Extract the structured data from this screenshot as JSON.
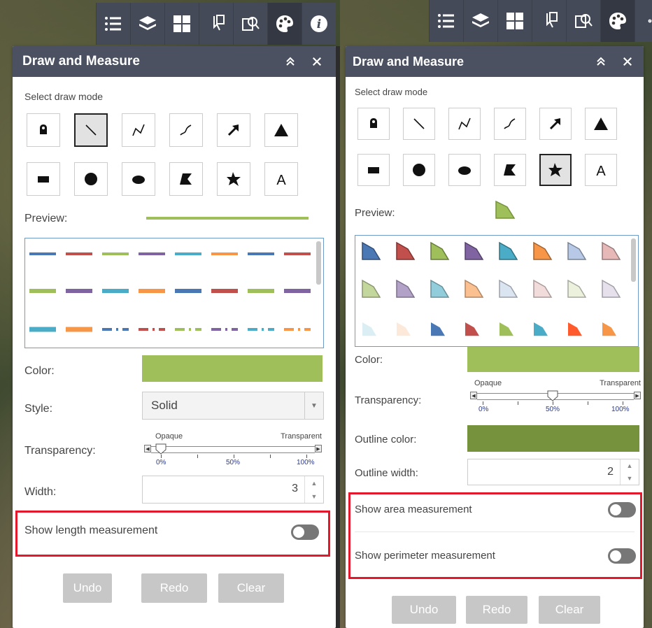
{
  "toolbar": {
    "icons": [
      "list-icon",
      "layers-icon",
      "grid-icon",
      "pointer-icon",
      "search-map-icon",
      "palette-icon",
      "info-icon"
    ],
    "active_index": 5
  },
  "left_panel": {
    "title": "Draw and Measure",
    "select_mode_label": "Select draw mode",
    "preview_label": "Preview:",
    "color_label": "Color:",
    "color_value": "#9ebf5a",
    "style_label": "Style:",
    "style_value": "Solid",
    "transparency_label": "Transparency:",
    "transparency": {
      "opaque": "Opaque",
      "transparent": "Transparent",
      "p0": "0%",
      "p50": "50%",
      "p100": "100%",
      "value": 0
    },
    "width_label": "Width:",
    "width_value": "3",
    "show_length_label": "Show length measurement",
    "show_length_on": false,
    "buttons": {
      "undo": "Undo",
      "redo": "Redo",
      "clear": "Clear"
    },
    "selected_mode": "line",
    "line_colors": [
      "#4a78b5",
      "#c1504d",
      "#9ebf5a",
      "#8064a2",
      "#4aacc6",
      "#f79646",
      "#4a78b5",
      "#c1504d"
    ]
  },
  "right_panel": {
    "title": "Draw and Measure",
    "select_mode_label": "Select draw mode",
    "preview_label": "Preview:",
    "color_label": "Color:",
    "color_value": "#9ebf5a",
    "transparency_label": "Transparency:",
    "transparency": {
      "opaque": "Opaque",
      "transparent": "Transparent",
      "p0": "0%",
      "p50": "50%",
      "p100": "100%",
      "value": 50
    },
    "outline_color_label": "Outline color:",
    "outline_color_value": "#76923c",
    "outline_width_label": "Outline width:",
    "outline_width_value": "2",
    "show_area_label": "Show area measurement",
    "show_area_on": false,
    "show_perimeter_label": "Show perimeter measurement",
    "show_perimeter_on": false,
    "buttons": {
      "undo": "Undo",
      "redo": "Redo",
      "clear": "Clear"
    },
    "selected_mode": "freehand-polygon",
    "fill_colors": [
      "#4a78b5",
      "#c1504d",
      "#9ebf5a",
      "#8064a2",
      "#4aacc6",
      "#f79646",
      "#b7c9e6",
      "#e6b9b8",
      "#c3d69b",
      "#b2a2c7",
      "#92cddc",
      "#fac090",
      "#dbe5f1",
      "#f2dcdb",
      "#ebf1dd",
      "#e5e0ec",
      "#daeef3",
      "#fde9d9",
      "#4a78b5",
      "#c1504d",
      "#9ebf5a",
      "#4aacc6",
      "#ff5b2d",
      "#f79646"
    ]
  }
}
